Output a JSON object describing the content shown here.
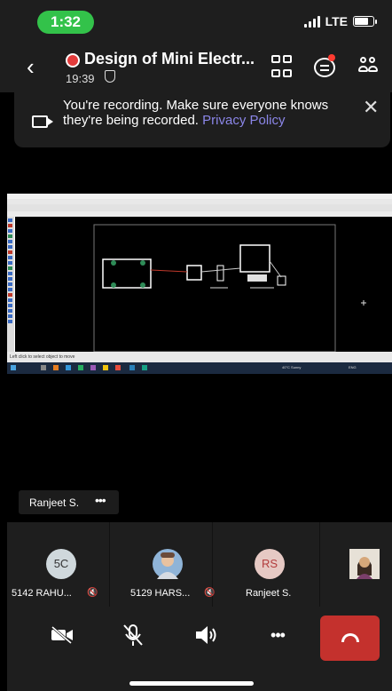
{
  "status_bar": {
    "time": "1:32",
    "network": "LTE"
  },
  "meeting": {
    "title": "Design of Mini Electr...",
    "elapsed": "19:39",
    "recording_color": "#e23b3b"
  },
  "banner": {
    "text": "You're recording. Make sure everyone knows they're being recorded.",
    "link": "Privacy Policy",
    "link_color": "#8b86e8"
  },
  "shared_screen": {
    "status_text": "Left click to select object to move",
    "tray_text": "40°C Sunny",
    "tray_lang": "ENG"
  },
  "active_speaker": {
    "name": "Ranjeet S.",
    "more": "•••"
  },
  "participants": [
    {
      "initials": "5C",
      "name": "5142 RAHU...",
      "muted": true,
      "avatar_color": "#cfd8dc"
    },
    {
      "initials": "",
      "name": "5129 HARS...",
      "muted": true,
      "avatar_color": "#8fb4d8"
    },
    {
      "initials": "RS",
      "name": "Ranjeet S.",
      "muted": false,
      "avatar_color": "#e6c9c4"
    },
    {
      "initials": "",
      "name": "",
      "muted": false,
      "avatar_color": "#c9a27a"
    }
  ],
  "controls": {
    "camera": "video-off-icon",
    "mic": "mic-off-icon",
    "speaker": "speaker-icon",
    "more": "•••",
    "hangup_color": "#c4312d"
  }
}
